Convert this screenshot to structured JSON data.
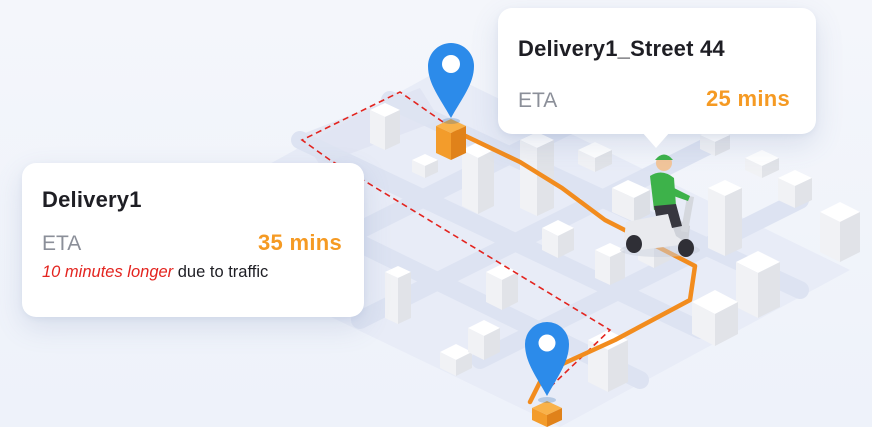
{
  "map": {
    "route_color": "#f28c1e",
    "alt_route_color": "#e3241f",
    "pin_color": "#2c8bea",
    "marker_color": "#f39c2b",
    "rider_shirt_color": "#3db24a",
    "icons": [
      "location-pin-icon",
      "location-pin-icon",
      "package-marker-icon",
      "package-marker-icon",
      "delivery-rider-icon"
    ]
  },
  "cards": {
    "left": {
      "title": "Delivery1",
      "eta_label": "ETA",
      "eta_value": "35 mins",
      "note_highlight": "10 minutes longer",
      "note_rest": " due to traffic"
    },
    "right": {
      "title": "Delivery1_Street 44",
      "eta_label": "ETA",
      "eta_value": "25 mins"
    }
  }
}
